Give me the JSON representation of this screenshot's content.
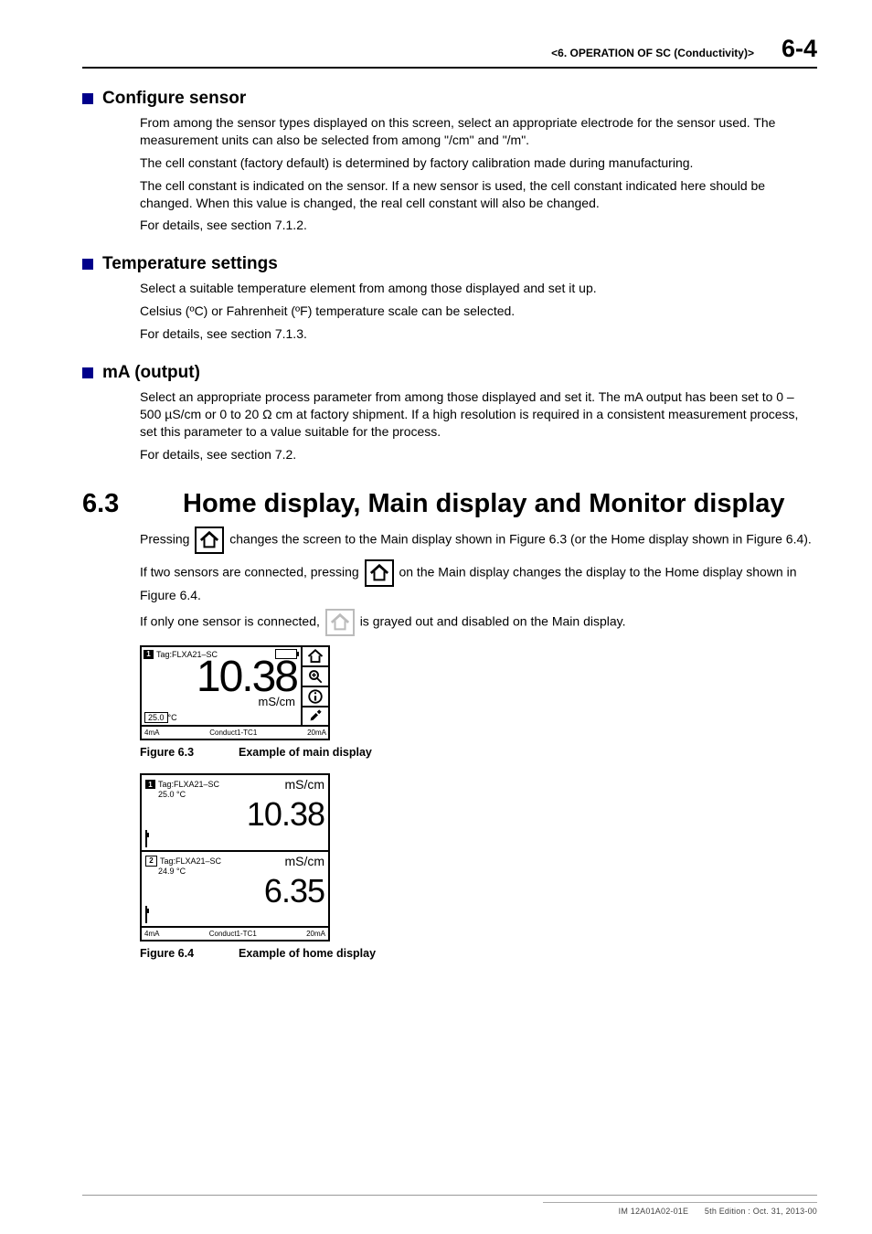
{
  "header": {
    "chapter": "<6.  OPERATION OF SC (Conductivity)>",
    "page": "6-4"
  },
  "sec_configure": {
    "title": "Configure sensor",
    "p1": "From among the sensor types displayed on this screen, select an appropriate electrode for the sensor used. The measurement units can also be selected from among \"/cm\" and \"/m\".",
    "p2": "The cell constant (factory default) is determined by factory calibration made during manufacturing.",
    "p3": "The cell constant is indicated on the sensor. If a new sensor is used, the cell constant indicated here should be changed. When this value is changed, the real cell constant will also be changed.",
    "p4": "For details, see section 7.1.2."
  },
  "sec_temp": {
    "title": "Temperature settings",
    "p1": "Select a suitable temperature element from among those displayed and set it up.",
    "p2": "Celsius (ºC) or Fahrenheit (ºF) temperature scale can be selected.",
    "p3": "For details, see section 7.1.3."
  },
  "sec_ma": {
    "title": "mA (output)",
    "p1": "Select an appropriate process parameter from among those displayed and set it. The mA output has been set to 0 – 500 µS/cm or 0 to 20 Ω cm at factory shipment. If a high resolution is required in a consistent measurement process, set this parameter to a value suitable for the process.",
    "p2": "For details, see section 7.2."
  },
  "sec_63": {
    "num": "6.3",
    "title": "Home display, Main display and Monitor display",
    "line1a": "Pressing ",
    "line1b": " changes the screen to the Main display shown in Figure 6.3 (or the Home display shown in Figure 6.4).",
    "line2a": "If two sensors are connected, pressing ",
    "line2b": " on the Main display changes the display to the Home display shown in Figure 6.4.",
    "line3a": "If only one sensor is connected, ",
    "line3b": " is grayed out and disabled on the Main display."
  },
  "fig63": {
    "label": "Figure 6.3",
    "caption": "Example of main display",
    "tag_num": "1",
    "tag": "Tag:FLXA21–SC",
    "value": "10.38",
    "unit": "mS/cm",
    "temp_val": "25.0",
    "temp_unit": "°C",
    "bottom_l": "4mA",
    "bottom_c": "Conduct1-TC1",
    "bottom_r": "20mA"
  },
  "fig64": {
    "label": "Figure 6.4",
    "caption": "Example of home display",
    "s1": {
      "num": "1",
      "tag": "Tag:FLXA21–SC",
      "unit": "mS/cm",
      "temp": "25.0  °C",
      "value": "10.38"
    },
    "s2": {
      "num": "2",
      "tag": "Tag:FLXA21–SC",
      "unit": "mS/cm",
      "temp": "24.9  °C",
      "value": "6.35"
    },
    "bottom_l": "4mA",
    "bottom_c": "Conduct1-TC1",
    "bottom_r": "20mA"
  },
  "footer": {
    "doc": "IM 12A01A02-01E",
    "edition": "5th Edition : Oct. 31, 2013-00"
  }
}
